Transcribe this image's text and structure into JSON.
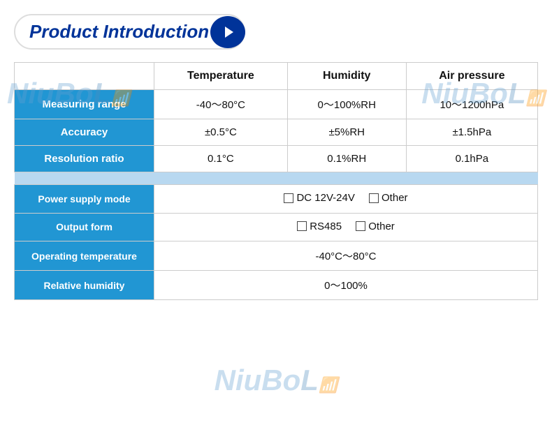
{
  "title": "Product Introduction",
  "watermark": "NiuBoL",
  "table": {
    "headers": [
      "",
      "Temperature",
      "Humidity",
      "Air pressure"
    ],
    "rows": [
      {
        "label": "Measuring range",
        "temperature": "-40～80°C",
        "humidity": "0～100%RH",
        "air_pressure": "10～1200hPa"
      },
      {
        "label": "Accuracy",
        "temperature": "±0.5°C",
        "humidity": "±5%RH",
        "air_pressure": "±1.5hPa"
      },
      {
        "label": "Resolution ratio",
        "temperature": "0.1°C",
        "humidity": "0.1%RH",
        "air_pressure": "0.1hPa"
      }
    ]
  },
  "bottom_rows": [
    {
      "label": "Power supply mode",
      "value": "DC 12V-24V",
      "extra": "Other"
    },
    {
      "label": "Output form",
      "value": "RS485",
      "extra": "Other"
    },
    {
      "label": "Operating temperature",
      "value": "-40°C～80°C",
      "extra": ""
    },
    {
      "label": "Relative humidity",
      "value": "0～100%",
      "extra": ""
    }
  ]
}
